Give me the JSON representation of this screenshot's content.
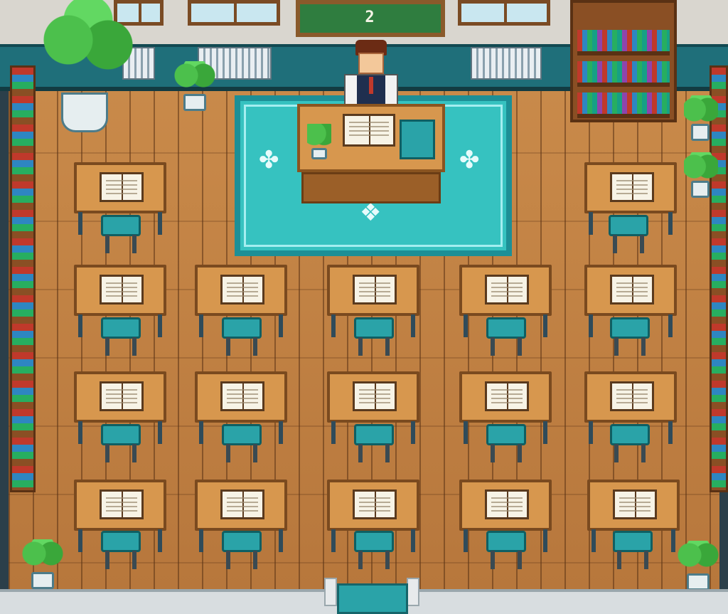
{
  "scene": {
    "chalkboard_text": "2",
    "colors": {
      "floor": "#c98a4a",
      "wall_trim": "#1f6f7a",
      "rug": "#36c2c0",
      "desk": "#d7974e",
      "chair": "#2aa3a8",
      "chalkboard": "#2f7d3f"
    }
  },
  "classroom": {
    "student_desk_rows": 4,
    "student_desk_columns": 5,
    "front_row_desks": 2,
    "each_desk_has": "open-book"
  },
  "teacher": {
    "desk_items": [
      "open-book",
      "potted-plant",
      "teal-chair"
    ]
  },
  "icons": [
    "chalkboard-icon",
    "plant-icon",
    "book-icon",
    "chair-icon",
    "radiator-icon",
    "bookshelf-icon",
    "door-icon"
  ]
}
